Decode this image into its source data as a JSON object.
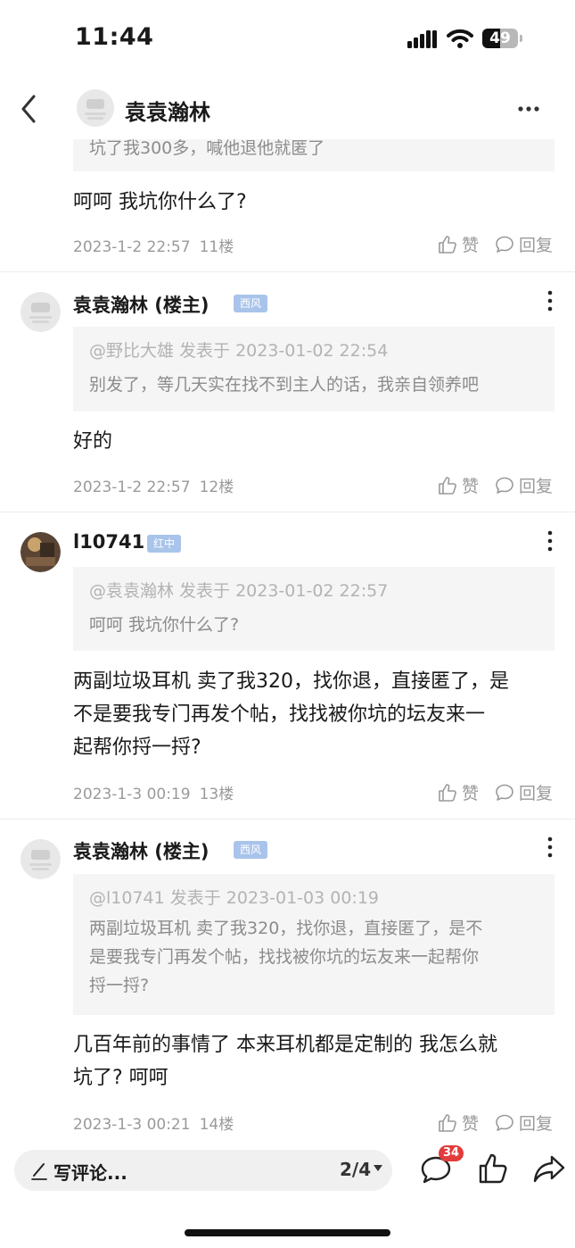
{
  "status_bar": {
    "time": "11:44",
    "battery": "49",
    "battery_level": 0.49
  },
  "nav": {
    "title": "袁袁瀚林"
  },
  "top_post": {
    "quote_tail": "坑了我300多，喊他退他就匿了",
    "content": "呵呵 我坑你什么了?",
    "date": "2023-1-2 22:57",
    "floor": "11楼"
  },
  "posts": [
    {
      "username": "袁袁瀚林 (楼主)",
      "badge": "西风",
      "quote_meta": "@野比大雄 发表于 2023-01-02 22:54",
      "quote_lines": [
        "别发了，等几天实在找不到主人的话，我亲自领养吧"
      ],
      "content_lines": [
        "好的"
      ],
      "date": "2023-1-2 22:57",
      "floor": "12楼"
    },
    {
      "username": "l10741",
      "badge": "红中",
      "quote_meta": "@袁袁瀚林 发表于 2023-01-02 22:57",
      "quote_lines": [
        "呵呵 我坑你什么了?"
      ],
      "content_lines": [
        "两副垃圾耳机 卖了我320，找你退，直接匿了，是",
        "不是要我专门再发个帖，找找被你坑的坛友来一",
        "起帮你捋一捋?"
      ],
      "date": "2023-1-3 00:19",
      "floor": "13楼"
    },
    {
      "username": "袁袁瀚林 (楼主)",
      "badge": "西风",
      "quote_meta": "@l10741 发表于 2023-01-03 00:19",
      "quote_lines": [
        "两副垃圾耳机 卖了我320，找你退，直接匿了，是不",
        "是要我专门再发个帖，找找被你坑的坛友来一起帮你",
        "捋一捋?"
      ],
      "content_lines": [
        "几百年前的事情了 本来耳机都是定制的 我怎么就",
        "坑了? 呵呵"
      ],
      "date": "2023-1-3 00:21",
      "floor": "14楼"
    }
  ],
  "actions": {
    "like": "赞",
    "reply": "回复"
  },
  "bottom_bar": {
    "write_placeholder": "写评论...",
    "pager": "2/4",
    "comment_count": "34"
  },
  "colors": {
    "badge": "#a9c4ea",
    "notif": "#e23c3c",
    "quote_bg": "#f5f5f5"
  }
}
